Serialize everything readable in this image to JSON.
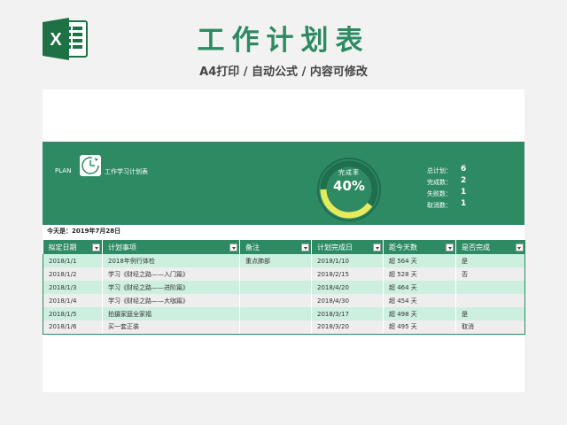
{
  "header": {
    "title": "工作计划表",
    "subtitle": "A4打印 / 自动公式 / 内容可修改",
    "logo_letter": "X",
    "logo_color": "#1e7145"
  },
  "banner": {
    "plan_label": "PLAN",
    "plan_name": "工作学习计划表",
    "rate_label": "完成率",
    "rate_value": "40%",
    "rate_fraction": 0.4,
    "stats": [
      {
        "label": "总计划：",
        "value": "6"
      },
      {
        "label": "完成数：",
        "value": "2"
      },
      {
        "label": "失败数：",
        "value": "1"
      },
      {
        "label": "取消数：",
        "value": "1"
      }
    ]
  },
  "today_text": "今天是：2019年7月28日",
  "table": {
    "columns": [
      "拟定日期",
      "计划事项",
      "备注",
      "计划完成日",
      "距今天数",
      "是否完成"
    ],
    "rows": [
      [
        "2018/1/1",
        "2018年例行体检",
        "重点肺部",
        "2018/1/10",
        "超 564 天",
        "是"
      ],
      [
        "2018/1/2",
        "学习《财经之路——入门篇》",
        "",
        "2018/2/15",
        "超 528 天",
        "否"
      ],
      [
        "2018/1/3",
        "学习《财经之路——进阶篇》",
        "",
        "2018/4/20",
        "超 464 天",
        ""
      ],
      [
        "2018/1/4",
        "学习《财经之路——大咖篇》",
        "",
        "2018/4/30",
        "超 454 天",
        ""
      ],
      [
        "2018/1/5",
        "拍摄家庭全家福",
        "",
        "2018/3/17",
        "超 498 天",
        "是"
      ],
      [
        "2018/1/6",
        "买一套正装",
        "",
        "2018/3/20",
        "超 495 天",
        "取消"
      ]
    ]
  },
  "colors": {
    "accent": "#2e8a63",
    "ring_progress": "#e8ea5e",
    "row_odd": "#ccefe0",
    "row_even": "#eeeeee"
  }
}
